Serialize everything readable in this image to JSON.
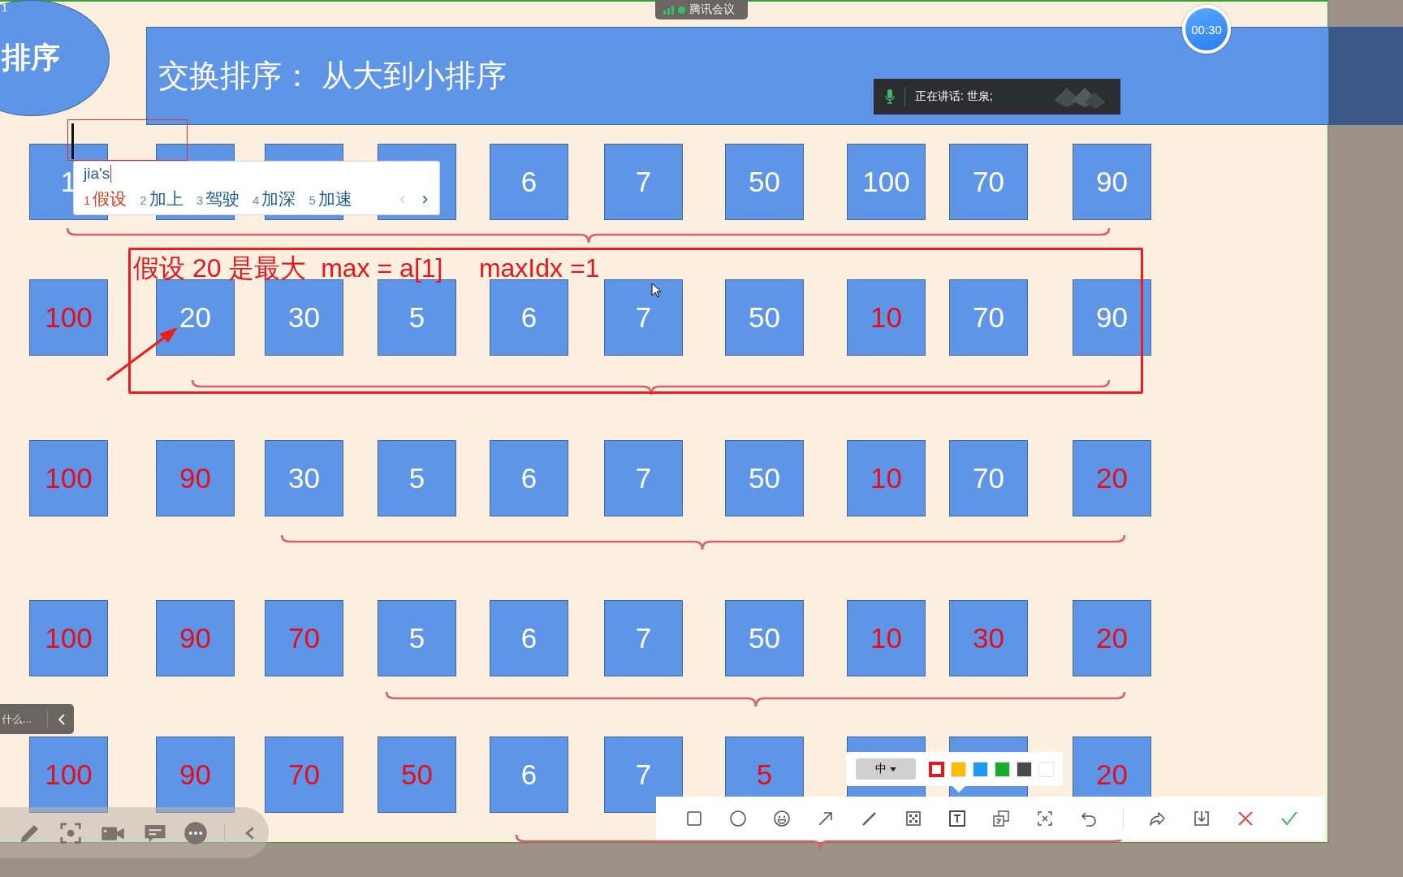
{
  "slide_number": "1",
  "badge": "排序",
  "title": "交换排序： 从大到小排序",
  "rows": [
    {
      "cells": [
        {
          "kind": "number",
          "value": "1",
          "highlight": false
        },
        {
          "kind": "covered"
        },
        {
          "kind": "covered"
        },
        {
          "kind": "covered"
        },
        {
          "kind": "number",
          "value": "6",
          "highlight": false
        },
        {
          "kind": "number",
          "value": "7",
          "highlight": false
        },
        {
          "kind": "number",
          "value": "50",
          "highlight": false
        },
        {
          "kind": "number",
          "value": "100",
          "highlight": false
        },
        {
          "kind": "number",
          "value": "70",
          "highlight": false
        },
        {
          "kind": "number",
          "value": "90",
          "highlight": false
        }
      ]
    },
    {
      "cells": [
        {
          "kind": "number",
          "value": "100",
          "highlight": true
        },
        {
          "kind": "number",
          "value": "20",
          "highlight": false
        },
        {
          "kind": "number",
          "value": "30",
          "highlight": false
        },
        {
          "kind": "number",
          "value": "5",
          "highlight": false
        },
        {
          "kind": "number",
          "value": "6",
          "highlight": false
        },
        {
          "kind": "number",
          "value": "7",
          "highlight": false
        },
        {
          "kind": "number",
          "value": "50",
          "highlight": false
        },
        {
          "kind": "number",
          "value": "10",
          "highlight": true
        },
        {
          "kind": "number",
          "value": "70",
          "highlight": false
        },
        {
          "kind": "number",
          "value": "90",
          "highlight": false
        }
      ]
    },
    {
      "cells": [
        {
          "kind": "number",
          "value": "100",
          "highlight": true
        },
        {
          "kind": "number",
          "value": "90",
          "highlight": true
        },
        {
          "kind": "number",
          "value": "30",
          "highlight": false
        },
        {
          "kind": "number",
          "value": "5",
          "highlight": false
        },
        {
          "kind": "number",
          "value": "6",
          "highlight": false
        },
        {
          "kind": "number",
          "value": "7",
          "highlight": false
        },
        {
          "kind": "number",
          "value": "50",
          "highlight": false
        },
        {
          "kind": "number",
          "value": "10",
          "highlight": true
        },
        {
          "kind": "number",
          "value": "70",
          "highlight": false
        },
        {
          "kind": "number",
          "value": "20",
          "highlight": true
        }
      ]
    },
    {
      "cells": [
        {
          "kind": "number",
          "value": "100",
          "highlight": true
        },
        {
          "kind": "number",
          "value": "90",
          "highlight": true
        },
        {
          "kind": "number",
          "value": "70",
          "highlight": true
        },
        {
          "kind": "number",
          "value": "5",
          "highlight": false
        },
        {
          "kind": "number",
          "value": "6",
          "highlight": false
        },
        {
          "kind": "number",
          "value": "7",
          "highlight": false
        },
        {
          "kind": "number",
          "value": "50",
          "highlight": false
        },
        {
          "kind": "number",
          "value": "10",
          "highlight": true
        },
        {
          "kind": "number",
          "value": "30",
          "highlight": true
        },
        {
          "kind": "number",
          "value": "20",
          "highlight": true
        }
      ]
    },
    {
      "cells": [
        {
          "kind": "number",
          "value": "100",
          "highlight": true
        },
        {
          "kind": "number",
          "value": "90",
          "highlight": true
        },
        {
          "kind": "number",
          "value": "70",
          "highlight": true
        },
        {
          "kind": "number",
          "value": "50",
          "highlight": true
        },
        {
          "kind": "number",
          "value": "6",
          "highlight": false
        },
        {
          "kind": "number",
          "value": "7",
          "highlight": false
        },
        {
          "kind": "number",
          "value": "5",
          "highlight": true
        },
        {
          "kind": "covered"
        },
        {
          "kind": "covered"
        },
        {
          "kind": "number",
          "value": "20",
          "highlight": true
        }
      ]
    }
  ],
  "annotation": "假设 20 是最大  max = a[1]     maxIdx =1",
  "ime": {
    "input": "jia's",
    "candidates": [
      {
        "index": "1",
        "text": "假设",
        "selected": true
      },
      {
        "index": "2",
        "text": "加上",
        "selected": false
      },
      {
        "index": "3",
        "text": "驾驶",
        "selected": false
      },
      {
        "index": "4",
        "text": "加深",
        "selected": false
      },
      {
        "index": "5",
        "text": "加速",
        "selected": false
      }
    ],
    "prev": "‹",
    "next": "›"
  },
  "meeting": {
    "app": "腾讯会议",
    "timer": "00:30",
    "speaking": "正在讲话: 世泉;"
  },
  "side_tab": "什么...",
  "palette": {
    "size": "中",
    "colors": [
      {
        "color": "#e8141e",
        "selected": true
      },
      {
        "color": "#fbbc05",
        "selected": false
      },
      {
        "color": "#1e9af0",
        "selected": false
      },
      {
        "color": "#1aab2a",
        "selected": false
      },
      {
        "color": "#4a4a4a",
        "selected": false
      },
      {
        "color": "#ffffff",
        "selected": false
      }
    ]
  }
}
